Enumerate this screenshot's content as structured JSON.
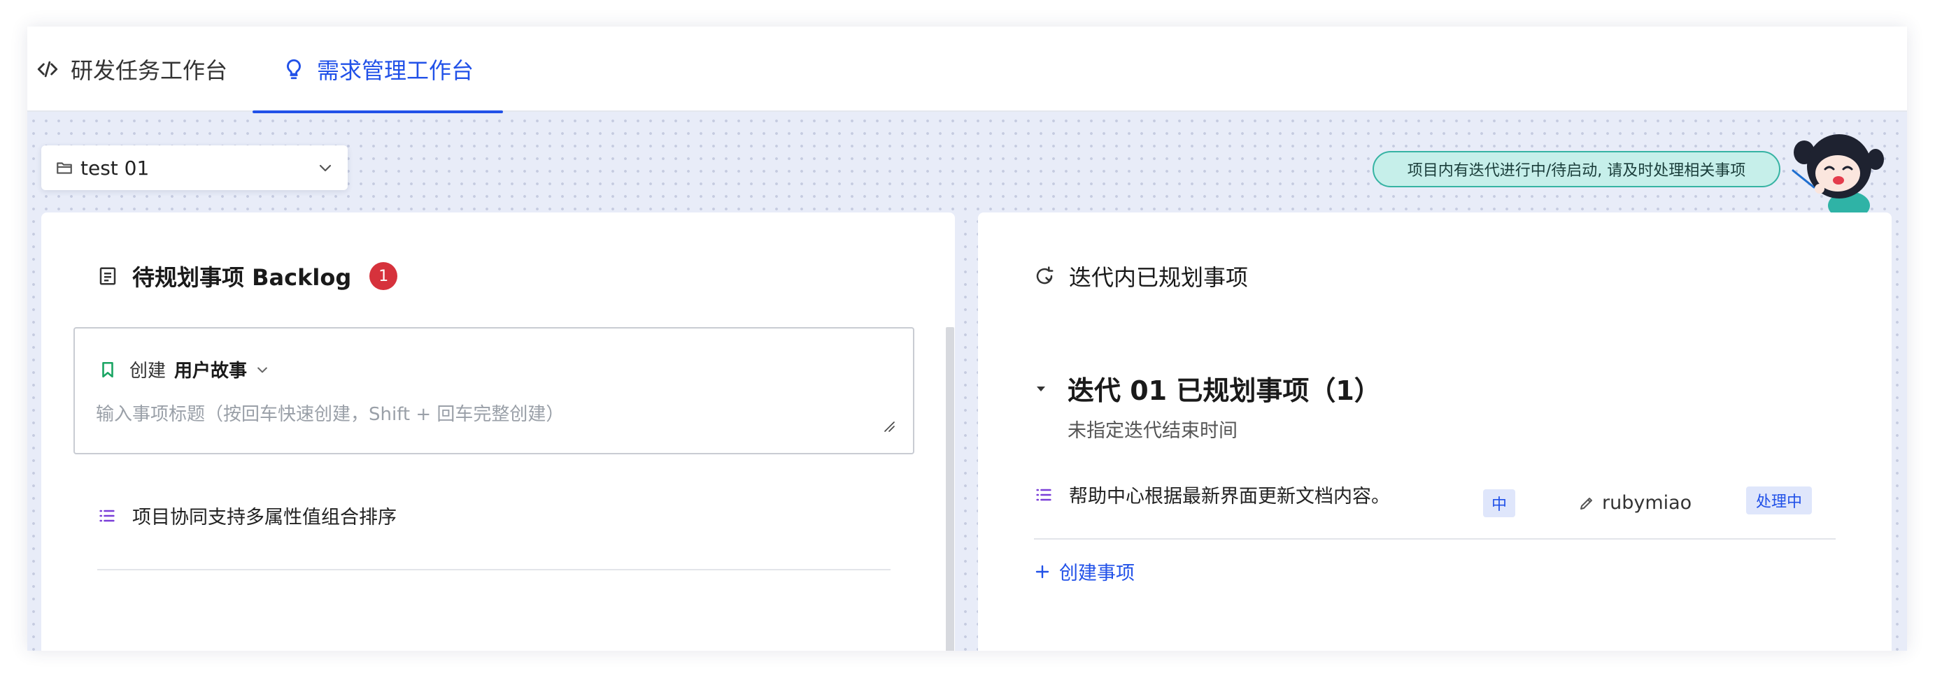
{
  "tabs": [
    {
      "label": "研发任务工作台",
      "icon": "code-icon",
      "active": false
    },
    {
      "label": "需求管理工作台",
      "icon": "lightbulb-icon",
      "active": true
    }
  ],
  "project_select": {
    "value": "test 01",
    "icon": "folder-icon"
  },
  "notice": {
    "text": "项目内有迭代进行中/待启动, 请及时处理相关事项"
  },
  "colors": {
    "accent": "#2151e8",
    "badge": "#d6323c",
    "notice_bg": "#c6efea",
    "story_green": "#1aa563",
    "list_purple": "#7a3ed8"
  },
  "backlog": {
    "title": "待规划事项 Backlog",
    "count": "1",
    "create": {
      "prefix": "创建",
      "type": "用户故事",
      "placeholder": "输入事项标题（按回车快速创建，Shift + 回车完整创建）"
    },
    "items": [
      {
        "title": "项目协同支持多属性值组合排序",
        "icon": "list-icon"
      }
    ]
  },
  "planned": {
    "title": "迭代内已规划事项",
    "iteration": {
      "title": "迭代 01 已规划事项（1）",
      "subtitle": "未指定迭代结束时间",
      "items": [
        {
          "title": "帮助中心根据最新界面更新文档内容。",
          "priority": "中",
          "owner": "rubymiao",
          "status": "处理中"
        }
      ]
    },
    "add_label": "创建事项"
  }
}
